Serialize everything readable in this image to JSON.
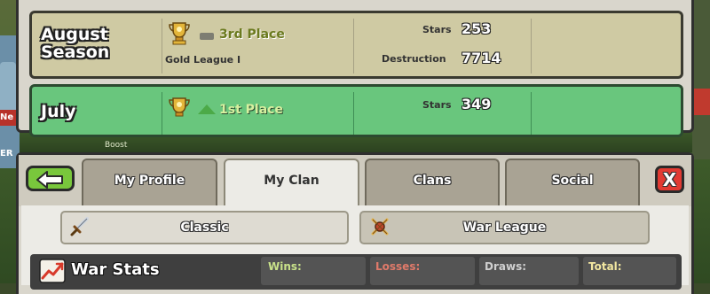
{
  "background": {
    "left_badge": "Ne",
    "left_label": "ER",
    "boost_label": "Boost"
  },
  "seasons": [
    {
      "month": "August",
      "month2": "Season",
      "place": "3rd Place",
      "league": "Gold League I",
      "stars_label": "Stars",
      "stars": "253",
      "destruction_label": "Destruction",
      "destruction": "7714",
      "trend": "none"
    },
    {
      "month": "July",
      "place": "1st Place",
      "stars_label": "Stars",
      "stars": "349",
      "trend": "up"
    }
  ],
  "tabs": [
    {
      "label": "My Profile",
      "active": false
    },
    {
      "label": "My Clan",
      "active": true
    },
    {
      "label": "Clans",
      "active": false
    },
    {
      "label": "Social",
      "active": false
    }
  ],
  "close_label": "X",
  "subtabs": {
    "classic": {
      "label": "Classic",
      "icon": "sword-icon"
    },
    "war_league": {
      "label": "War League",
      "icon": "crossed-swords-icon"
    }
  },
  "war_stats": {
    "title": "War Stats",
    "wins_label": "Wins:",
    "losses_label": "Losses:",
    "draws_label": "Draws:",
    "total_label": "Total:"
  },
  "colors": {
    "accent_green": "#79c73c",
    "close_red": "#e23a32",
    "wins_green": "#c9e28a",
    "losses_red": "#e07a6a",
    "draws_gray": "#d0d0d0",
    "total_yellow": "#f2e7a0"
  }
}
